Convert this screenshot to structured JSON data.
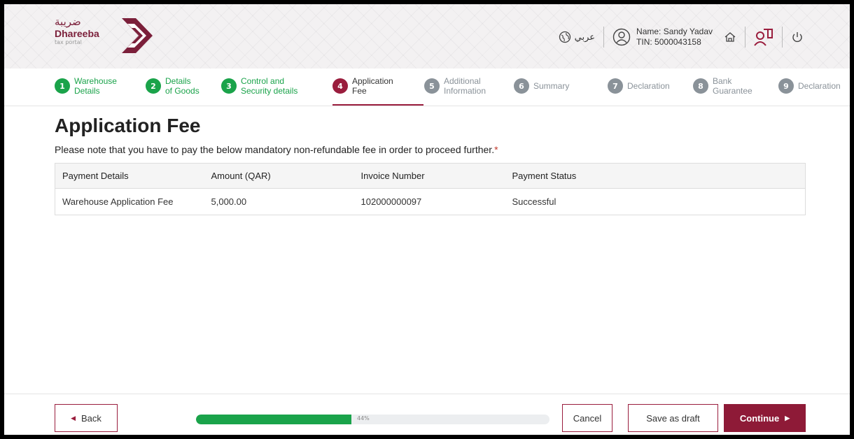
{
  "header": {
    "logo_arabic": "ضريبة",
    "logo_english": "Dhareeba",
    "logo_sub": "tax portal",
    "language_label": "عربي",
    "user_name": "Name: Sandy Yadav",
    "user_tin": "TIN: 5000043158",
    "icons": [
      "globe-icon",
      "user-circle-icon",
      "home-icon",
      "people-book-icon",
      "power-icon"
    ]
  },
  "steps": [
    {
      "num": "1",
      "label_line1": "Warehouse",
      "label_line2": "Details",
      "state": "done"
    },
    {
      "num": "2",
      "label_line1": "Details",
      "label_line2": "of Goods",
      "state": "done"
    },
    {
      "num": "3",
      "label_line1": "Control and",
      "label_line2": "Security details",
      "state": "done"
    },
    {
      "num": "4",
      "label_line1": "Application",
      "label_line2": "Fee",
      "state": "active"
    },
    {
      "num": "5",
      "label_line1": "Additional",
      "label_line2": "Information",
      "state": "todo"
    },
    {
      "num": "6",
      "label_line1": "Summary",
      "label_line2": "",
      "state": "todo"
    },
    {
      "num": "7",
      "label_line1": "Declaration",
      "label_line2": "",
      "state": "todo"
    },
    {
      "num": "8",
      "label_line1": "Bank",
      "label_line2": "Guarantee",
      "state": "todo"
    },
    {
      "num": "9",
      "label_line1": "Declaration",
      "label_line2": "",
      "state": "todo"
    }
  ],
  "main": {
    "title": "Application Fee",
    "note": "Please note that you have to pay the below mandatory non-refundable fee in order to proceed further.",
    "required_mark": "*",
    "table": {
      "headers": [
        "Payment Details",
        "Amount (QAR)",
        "Invoice Number",
        "Payment Status"
      ],
      "rows": [
        [
          "Warehouse Application Fee",
          "5,000.00",
          "102000000097",
          "Successful"
        ]
      ]
    }
  },
  "footer": {
    "back_label": "Back",
    "cancel_label": "Cancel",
    "save_draft_label": "Save as draft",
    "continue_label": "Continue",
    "progress_percent": 44,
    "progress_text": "44%"
  },
  "colors": {
    "brand": "#9a1d3d",
    "success": "#1aa34a",
    "status_success_text": "#4cd964"
  }
}
